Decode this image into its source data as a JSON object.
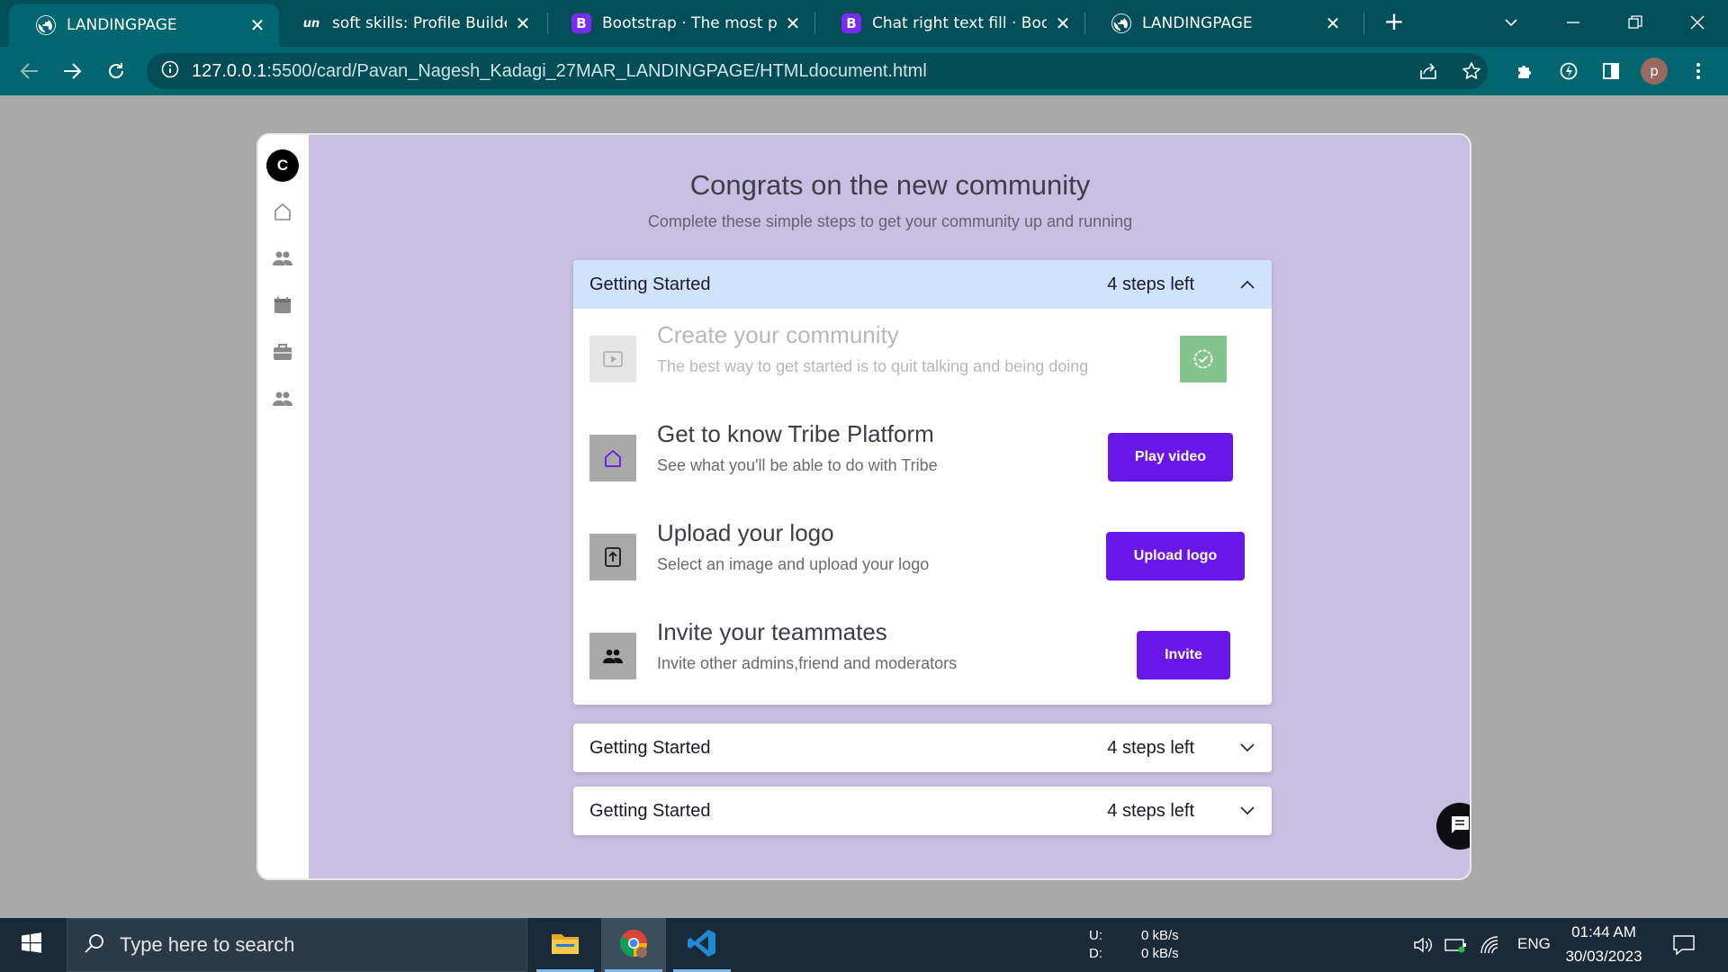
{
  "browser": {
    "tabs": [
      {
        "title": "LANDINGPAGE",
        "favicon": "globe-icon",
        "active": true
      },
      {
        "title": "soft skills: Profile Builder p",
        "favicon": "unstop-icon",
        "favicon_text": "un",
        "active": false
      },
      {
        "title": "Bootstrap · The most pop",
        "favicon": "bootstrap-icon",
        "favicon_text": "B",
        "active": false
      },
      {
        "title": "Chat right text fill · Bootst",
        "favicon": "bootstrap-icon",
        "favicon_text": "B",
        "active": false
      },
      {
        "title": "LANDINGPAGE",
        "favicon": "globe-icon",
        "active": false
      }
    ],
    "tab_close_glyph": "✕",
    "new_tab_glyph": "+",
    "url_host": "127.0.0.1",
    "url_path": ":5500/card/Pavan_Nagesh_Kadagi_27MAR_LANDINGPAGE/HTMLdocument.html",
    "profile_initial": "p",
    "colors": {
      "tabbar": "#024f5a",
      "toolbar": "#01666f"
    }
  },
  "app": {
    "logo_letter": "C",
    "sidebar_icons": [
      "home-icon",
      "people-icon",
      "calendar-icon",
      "briefcase-icon",
      "group-icon"
    ],
    "title": "Congrats on the new community",
    "subtitle": "Complete these simple steps to get your community up and running",
    "colors": {
      "background": "#c8bfe3",
      "accent": "#6b16e8",
      "header_open": "#d1e2fc",
      "done": "#84c48c"
    },
    "sections": [
      {
        "title": "Getting Started",
        "steps_left": "4 steps left",
        "expanded": true,
        "steps": [
          {
            "title": "Create your community",
            "description": "The best way to get started is to quit talking and being doing",
            "icon": "play-icon",
            "completed": true
          },
          {
            "title": "Get to know Tribe Platform",
            "description": "See what you'll be able to do with Tribe",
            "icon": "home-outline-icon",
            "button": "Play video"
          },
          {
            "title": "Upload your logo",
            "description": "Select an image and upload your logo",
            "icon": "upload-icon",
            "button": "Upload logo"
          },
          {
            "title": "Invite your teammates",
            "description": "Invite other admins,friend and moderators",
            "icon": "people-icon",
            "button": "Invite"
          }
        ]
      },
      {
        "title": "Getting Started",
        "steps_left": "4 steps left",
        "expanded": false
      },
      {
        "title": "Getting Started",
        "steps_left": "4 steps left",
        "expanded": false
      }
    ]
  },
  "taskbar": {
    "search_placeholder": "Type here to search",
    "net_up_label": "U:",
    "net_up_value": "0 kB/s",
    "net_down_label": "D:",
    "net_down_value": "0 kB/s",
    "language": "ENG",
    "time": "01:44 AM",
    "date": "30/03/2023"
  }
}
